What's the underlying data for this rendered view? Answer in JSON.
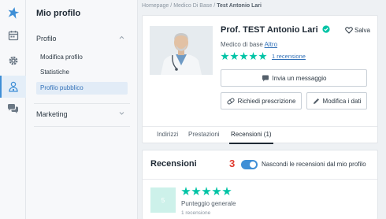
{
  "rail": {
    "items": [
      "logo-icon",
      "calendar-icon",
      "gear-icon",
      "doctor-icon",
      "chat-icon"
    ],
    "active": "doctor-icon"
  },
  "sidebar": {
    "title": "Mio profilo",
    "sections": [
      {
        "label": "Profilo",
        "expanded": true
      },
      {
        "label": "Marketing",
        "expanded": false
      }
    ],
    "items": [
      {
        "label": "Modifica profilo"
      },
      {
        "label": "Statistiche"
      },
      {
        "label": "Profilo pubblico",
        "selected": true
      }
    ]
  },
  "breadcrumb": {
    "items": [
      "Homepage",
      "Medico Di Base",
      "Test Antonio Lari"
    ],
    "separator": "/"
  },
  "profile": {
    "name": "Prof. TEST Antonio Lari",
    "save_label": "Salva",
    "specialty_label": "Medico di base",
    "specialty_link": "Altro",
    "stars": 5,
    "reviews_link": "1 recensione"
  },
  "buttons": {
    "message": "Invia un messaggio",
    "prescription": "Richiedi prescrizione",
    "edit": "Modifica i dati"
  },
  "tabs": [
    {
      "label": "Indirizzi"
    },
    {
      "label": "Prestazioni"
    },
    {
      "label": "Recensioni (1)",
      "active": true
    }
  ],
  "reviews": {
    "title": "Recensioni",
    "annotation": "3",
    "toggle_label": "Nascondi le recensioni dal mio profilo",
    "toggle_on": true,
    "score": "5",
    "stars": 5,
    "overall_label": "Punteggio generale",
    "count_label": "1 recensione"
  },
  "colors": {
    "accent": "#3f8fd6",
    "star": "#00c3a5",
    "annotation": "#e03a2e",
    "verified": "#00c3a5"
  }
}
